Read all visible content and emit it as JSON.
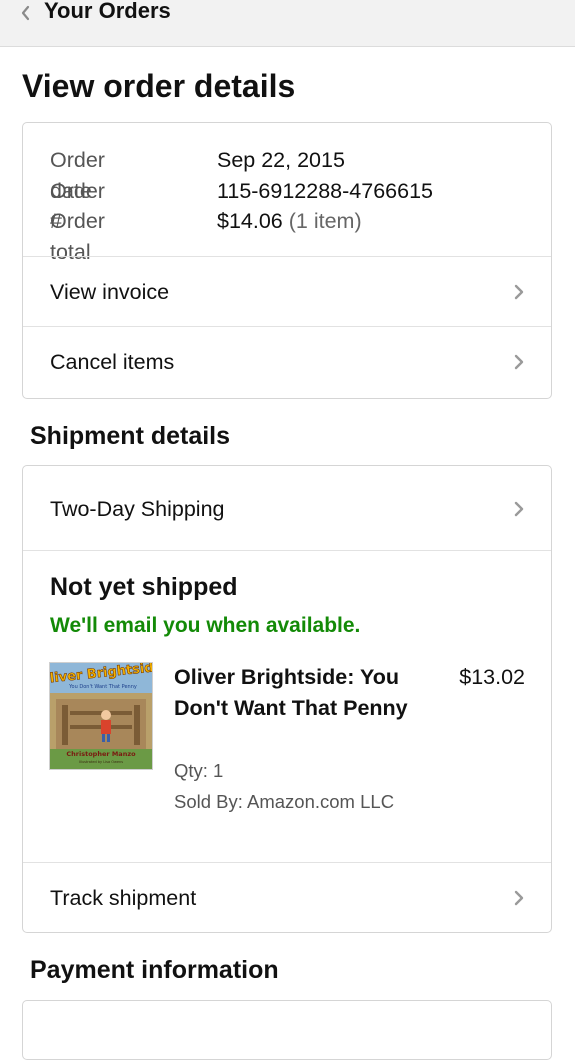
{
  "header": {
    "title": "Your Orders"
  },
  "page": {
    "title": "View order details"
  },
  "summary": {
    "rows": [
      {
        "label": "Order date",
        "value": "Sep 22, 2015"
      },
      {
        "label": "Order #",
        "value": "115-6912288-4766615"
      },
      {
        "label": "Order total",
        "value": "$14.06",
        "note": "(1 item)"
      }
    ],
    "links": [
      {
        "label": "View invoice"
      },
      {
        "label": "Cancel items"
      }
    ]
  },
  "shipment": {
    "section_title": "Shipment details",
    "method": "Two-Day Shipping",
    "status": "Not yet shipped",
    "status_note": "We'll email you when available.",
    "item": {
      "title": "Oliver Brightside: You Don't Want That Penny",
      "price": "$13.02",
      "qty": "Qty: 1",
      "seller": "Sold By: Amazon.com LLC",
      "cover": {
        "title_art": "Oliver Brightside",
        "subtitle_art": "You Don't Want That Penny",
        "author_art": "Christopher Manzo",
        "illustrator_art": "Illustrated by Lisa Owens"
      }
    },
    "track_label": "Track shipment"
  },
  "payment": {
    "section_title": "Payment information"
  },
  "colors": {
    "accent_green": "#138a07",
    "border": "#d5d5d5",
    "chevron": "#9a9a9a",
    "header_bg": "#f2f2f2"
  },
  "icons": [
    "back-chevron-icon",
    "chevron-right-icon"
  ]
}
